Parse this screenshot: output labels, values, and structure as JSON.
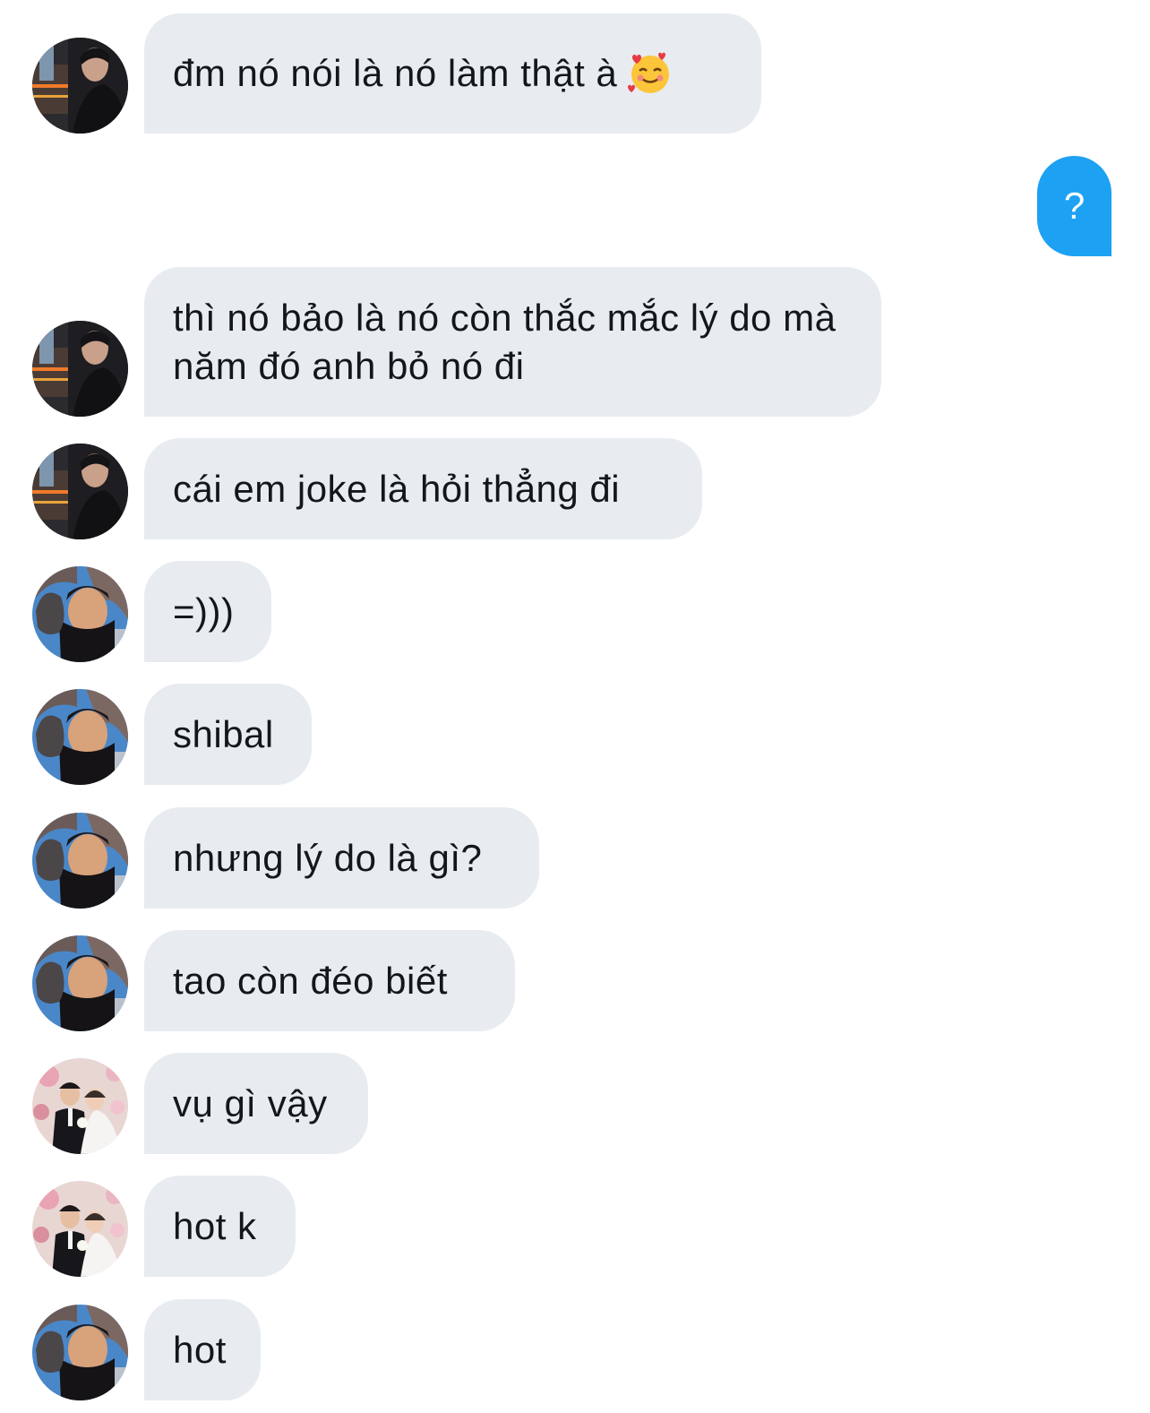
{
  "messages": [
    {
      "sender": "avatar-a",
      "text": "đm nó nói là nó làm thật à",
      "emoji": "smiling-face-with-hearts-icon"
    },
    {
      "sender": "me",
      "text": "?"
    },
    {
      "sender": "avatar-a",
      "text": "thì nó bảo là nó còn thắc mắc lý do mà năm đó anh bỏ nó đi"
    },
    {
      "sender": "avatar-a",
      "text": "cái em joke là hỏi thẳng đi"
    },
    {
      "sender": "avatar-b",
      "text": "=)))"
    },
    {
      "sender": "avatar-b",
      "text": "shibal"
    },
    {
      "sender": "avatar-b",
      "text": "nhưng lý do là gì?"
    },
    {
      "sender": "avatar-b",
      "text": "tao còn đéo biết"
    },
    {
      "sender": "avatar-c",
      "text": "vụ gì vậy"
    },
    {
      "sender": "avatar-c",
      "text": "hot k"
    },
    {
      "sender": "avatar-b",
      "text": "hot"
    }
  ],
  "colors": {
    "incoming_bubble": "#e8ecf0",
    "outgoing_bubble": "#1da1f2",
    "incoming_text": "#14171a",
    "outgoing_text": "#ffffff"
  }
}
